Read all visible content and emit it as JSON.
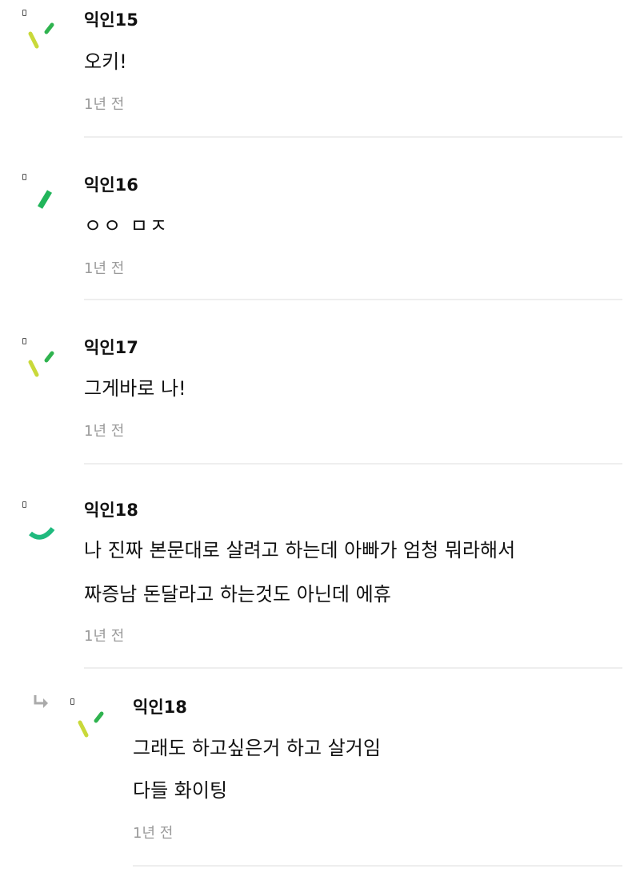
{
  "comments": [
    {
      "author": "익인15",
      "lines": [
        "오키!"
      ],
      "time": "1년 전",
      "avatar_icon": "slash-pair-icon",
      "avatar_colors": [
        "#c9d93a",
        "#2fb34f"
      ]
    },
    {
      "author": "익인16",
      "lines": [
        "ㅇㅇ ㅁㅈ"
      ],
      "time": "1년 전",
      "avatar_icon": "single-stroke-icon",
      "avatar_colors": [
        "#21b55a"
      ]
    },
    {
      "author": "익인17",
      "lines": [
        "그게바로 나!"
      ],
      "time": "1년 전",
      "avatar_icon": "slash-pair-icon",
      "avatar_colors": [
        "#c9d93a",
        "#2fb34f"
      ]
    },
    {
      "author": "익인18",
      "lines": [
        "나 진짜 본문대로 살려고 하는데 아빠가 엄청 뭐라해서",
        "짜증남 돈달라고 하는것도 아닌데 에휴"
      ],
      "time": "1년 전",
      "avatar_icon": "arc-icon",
      "avatar_colors": [
        "#1fba7e"
      ]
    }
  ],
  "reply": {
    "author": "익인18",
    "lines": [
      "그래도 하고싶은거 하고 살거임",
      "다들 화이팅"
    ],
    "time": "1년 전",
    "avatar_icon": "slash-pair-icon",
    "avatar_colors": [
      "#c9d93a",
      "#2fb34f"
    ],
    "reply_icon": "reply-arrow-icon"
  }
}
